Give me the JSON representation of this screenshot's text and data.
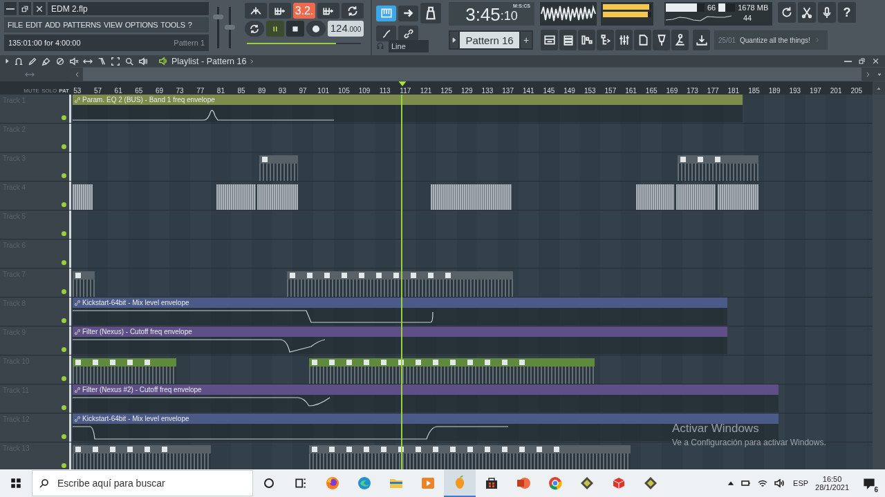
{
  "window": {
    "title": "EDM 2.flp"
  },
  "menu": [
    "FILE",
    "EDIT",
    "ADD",
    "PATTERNS",
    "VIEW",
    "OPTIONS",
    "TOOLS",
    "?"
  ],
  "hint_bar": {
    "text": "135:01:00 for 4:00:00",
    "pattern": "Pattern 1"
  },
  "mixer_sliders": [
    {
      "level": 0.85
    },
    {
      "level": 0.55
    }
  ],
  "transport": {
    "countdown": "3.2.",
    "playing": true,
    "tempo": "124",
    "tempo_fraction": ".000",
    "position": {
      "level": 0.78
    },
    "snap": "Line"
  },
  "time": {
    "value": "3:45",
    "centis": ":10",
    "label": "M:S:CS"
  },
  "peak_meters": [
    {
      "level": 0.95
    },
    {
      "level": 0.93
    }
  ],
  "monitor": {
    "cpu": "66",
    "cpu_meter": {
      "level": 0.8
    },
    "memory": "1678 MB",
    "memory_meter": {
      "level": 0.4
    },
    "polyphony": "44"
  },
  "help": "?",
  "pattern_selector": {
    "value": "Pattern 16",
    "add": "+"
  },
  "news": {
    "date": "25/01",
    "text": "Quantize all the things!"
  },
  "playlist": {
    "title": "Playlist - Pattern 16",
    "header_labels": [
      "MUTE",
      "SOLO",
      "PAT"
    ],
    "ruler": [
      "53",
      "57",
      "61",
      "65",
      "69",
      "73",
      "77",
      "81",
      "85",
      "89",
      "93",
      "97",
      "101",
      "105",
      "109",
      "113",
      "117",
      "121",
      "125",
      "129",
      "133",
      "137",
      "141",
      "145",
      "149",
      "153",
      "157",
      "161",
      "165",
      "169",
      "173",
      "177",
      "181",
      "185",
      "189",
      "193",
      "197",
      "201",
      "205"
    ]
  },
  "tracks": [
    {
      "name": "Track 1",
      "active": true,
      "clips": [
        {
          "kind": "automation",
          "label": "Param. EQ 2 (BUS) - Band 1 freq envelope",
          "color": "#7d8b4c"
        }
      ]
    },
    {
      "name": "Track 2",
      "active": true
    },
    {
      "name": "Track 3",
      "active": true,
      "clips": [
        {
          "kind": "pattern",
          "color": "#596168"
        },
        {
          "kind": "pattern",
          "color": "#596168"
        }
      ]
    },
    {
      "name": "Track 4",
      "active": true,
      "clips": [
        {
          "kind": "audio",
          "color": "#aab2b7"
        },
        {
          "kind": "audio",
          "color": "#aab2b7"
        },
        {
          "kind": "audio",
          "color": "#aab2b7"
        },
        {
          "kind": "audio",
          "color": "#aab2b7"
        },
        {
          "kind": "audio",
          "color": "#aab2b7"
        },
        {
          "kind": "audio",
          "color": "#aab2b7"
        },
        {
          "kind": "audio",
          "color": "#aab2b7"
        }
      ]
    },
    {
      "name": "Track 5",
      "active": true
    },
    {
      "name": "Track 6",
      "active": true
    },
    {
      "name": "Track 7",
      "active": true,
      "clips": [
        {
          "kind": "pattern",
          "color": "#596168"
        },
        {
          "kind": "pattern",
          "color": "#596168"
        }
      ]
    },
    {
      "name": "Track 8",
      "active": true,
      "clips": [
        {
          "kind": "automation",
          "label": "Kickstart-64bit - Mix level envelope",
          "color": "#4c5a88"
        }
      ]
    },
    {
      "name": "Track 9",
      "active": true,
      "clips": [
        {
          "kind": "automation",
          "label": "Filter (Nexus) - Cutoff freq envelope",
          "color": "#5e4f86"
        }
      ]
    },
    {
      "name": "Track 10",
      "active": true,
      "clips": [
        {
          "kind": "pattern",
          "color": "#5f8a3c"
        },
        {
          "kind": "pattern",
          "color": "#5f8a3c"
        }
      ]
    },
    {
      "name": "Track 11",
      "active": true,
      "clips": [
        {
          "kind": "automation",
          "label": "Filter (Nexus #2) - Cutoff freq envelope",
          "color": "#5e4f86"
        }
      ]
    },
    {
      "name": "Track 12",
      "active": true,
      "clips": [
        {
          "kind": "automation",
          "label": "Kickstart-64bit - Mix level envelope",
          "color": "#4c5a88"
        }
      ]
    },
    {
      "name": "Track 13",
      "active": true,
      "clips": [
        {
          "kind": "pattern",
          "color": "#596168"
        },
        {
          "kind": "pattern",
          "color": "#596168"
        }
      ]
    }
  ],
  "activation_notice": {
    "title": "Activar Windows",
    "text": "Ve a Configuración para activar Windows."
  },
  "taskbar": {
    "search_placeholder": "Escribe aquí para buscar",
    "apps": [
      {
        "kind": "cortana",
        "selected": false
      },
      {
        "kind": "taskview",
        "selected": false
      },
      {
        "kind": "firefox",
        "selected": false
      },
      {
        "kind": "edge",
        "selected": false
      },
      {
        "kind": "explorer",
        "selected": false
      },
      {
        "kind": "player",
        "selected": false
      },
      {
        "kind": "fl",
        "selected": true
      },
      {
        "kind": "store",
        "selected": false
      },
      {
        "kind": "powerpoint",
        "selected": false
      },
      {
        "kind": "chrome",
        "selected": false
      },
      {
        "kind": "app",
        "selected": false
      },
      {
        "kind": "sketchup",
        "selected": false
      },
      {
        "kind": "app",
        "selected": false
      }
    ],
    "language": "ESP",
    "time": "16:50",
    "date": "28/1/2021",
    "notifications": "6"
  }
}
